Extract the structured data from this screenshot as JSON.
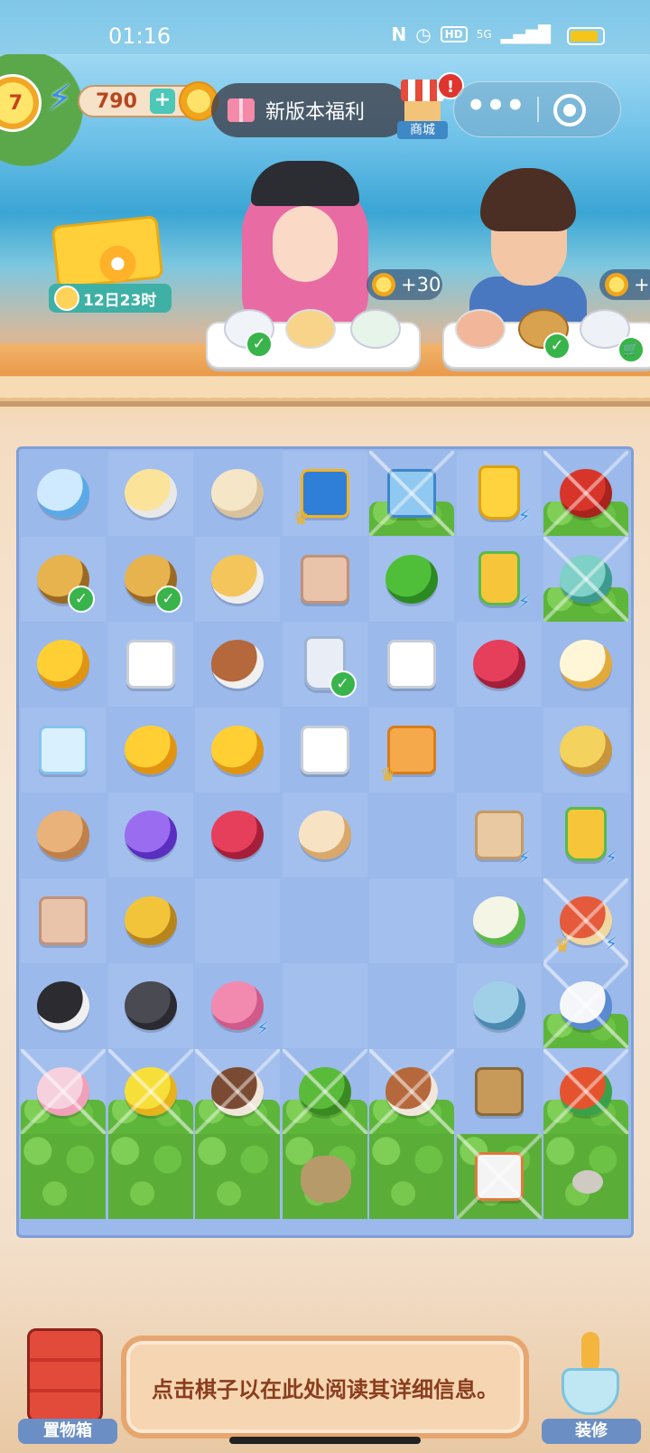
{
  "status_bar": {
    "time": "01:16",
    "network_label": "5G",
    "hd_label": "HD"
  },
  "hud": {
    "level": "7",
    "coins": "790",
    "coin_plus": "+",
    "notice": "新版本福利",
    "shop_label": "商城",
    "alert": "!"
  },
  "event": {
    "timer": "12日23时"
  },
  "customers": [
    {
      "reward": "+30"
    },
    {
      "reward": "+"
    }
  ],
  "board": {
    "cells": [
      [
        "ice bowl",
        "egg custard",
        "bun roll",
        "treasure chest",
        "ice cooler",
        "water bucket",
        "cherries"
      ],
      [
        "steamer",
        "steamer",
        "soup bowl",
        "paper bag",
        "green pepper",
        "juicer",
        "seafood bowl"
      ],
      [
        "coin stack",
        "tea bag",
        "tea cup",
        "tea mug",
        "tea bag",
        "ruby gems",
        "strainer"
      ],
      [
        "ice cube",
        "coin",
        "coin pair",
        "tea bag",
        "mystery box",
        "",
        "fish"
      ],
      [
        "cat",
        "magic orb",
        "ruby gems",
        "meat bun",
        "",
        "shopping bag",
        "juicer"
      ],
      [
        "paper bag",
        "coin press",
        "",
        "",
        "",
        "lemon squeezer",
        "fish platter"
      ],
      [
        "black cat",
        "gray cat",
        "macaron",
        "",
        "",
        "blue bowl",
        "teapot"
      ],
      [
        "cupcake",
        "lemon tart",
        "ice cream bowl",
        "broccoli",
        "fish dish",
        "spatula",
        "seafood platter"
      ],
      [
        "grass",
        "grass",
        "grass",
        "dirt",
        "grass",
        "fish tray",
        "rock"
      ]
    ]
  },
  "bottom": {
    "storage_label": "置物箱",
    "info_text": "点击棋子以在此处阅读其详细信息。",
    "decorate_label": "装修"
  },
  "colors": {
    "board": "#9bb9ea",
    "check": "#38b44a",
    "accent": "#e7a66f"
  }
}
